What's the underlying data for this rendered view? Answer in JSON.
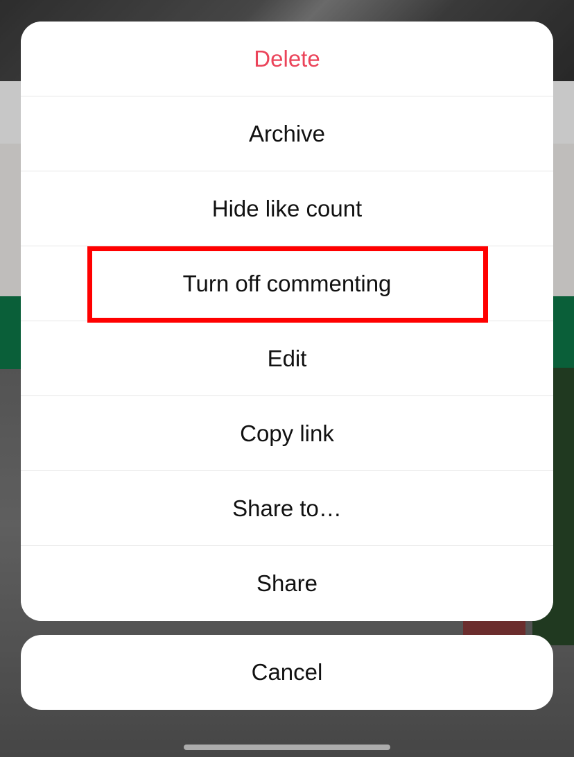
{
  "menu": {
    "items": [
      {
        "label": "Delete",
        "destructive": true,
        "name": "menu-item-delete"
      },
      {
        "label": "Archive",
        "destructive": false,
        "name": "menu-item-archive"
      },
      {
        "label": "Hide like count",
        "destructive": false,
        "name": "menu-item-hide-like-count"
      },
      {
        "label": "Turn off commenting",
        "destructive": false,
        "name": "menu-item-turn-off-commenting",
        "highlighted": true
      },
      {
        "label": "Edit",
        "destructive": false,
        "name": "menu-item-edit"
      },
      {
        "label": "Copy link",
        "destructive": false,
        "name": "menu-item-copy-link"
      },
      {
        "label": "Share to…",
        "destructive": false,
        "name": "menu-item-share-to"
      },
      {
        "label": "Share",
        "destructive": false,
        "name": "menu-item-share"
      }
    ]
  },
  "cancel_label": "Cancel"
}
